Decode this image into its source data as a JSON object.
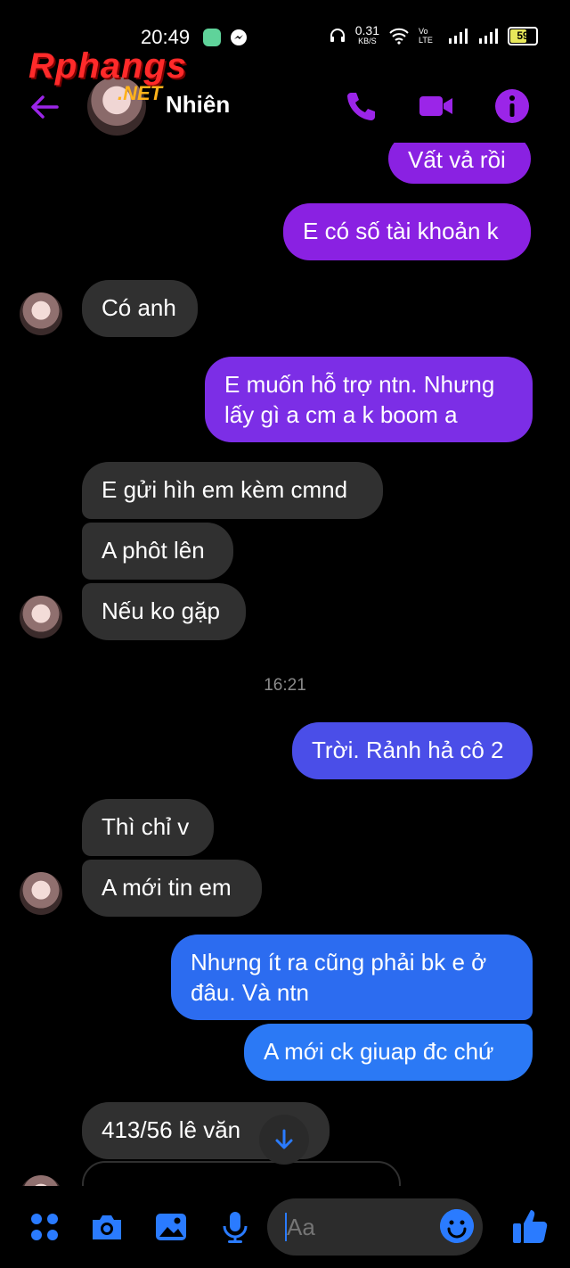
{
  "status_bar": {
    "time": "20:49",
    "net_speed": "0.31",
    "net_unit": "KB/S",
    "volte": "Vo LTE",
    "battery": "59"
  },
  "header": {
    "contact_name": "Nhiên",
    "watermark_main": "Rphangs",
    "watermark_sub": ".NET",
    "accent_color": "#9b25e8"
  },
  "messages": [
    {
      "dir": "out",
      "text": "Vất vả rồi",
      "color": "#8a21e2"
    },
    {
      "dir": "out",
      "text": "E có số tài khoản k",
      "color": "#8a21e2"
    },
    {
      "dir": "in",
      "text": "Có anh"
    },
    {
      "dir": "out",
      "lines": [
        "E muốn hỗ trợ ntn. Nhưng",
        "lấy gì a cm a k boom a"
      ],
      "color": "#7c2ee6"
    },
    {
      "dir": "in",
      "text": "E gửi hìh em kèm cmnd"
    },
    {
      "dir": "in",
      "text": "A phôt lên"
    },
    {
      "dir": "in",
      "text": "Nếu ko gặp"
    },
    {
      "dir": "in",
      "text": "Thì chỉ v"
    },
    {
      "dir": "in",
      "text": "A mới tin em"
    },
    {
      "dir": "out",
      "text": "Trời. Rảnh hả cô 2",
      "color": "#4a4ee8"
    },
    {
      "dir": "out",
      "lines": [
        "Nhưng ít ra cũng phải bk e ở",
        "đâu. Và ntn"
      ],
      "color": "#2c6cf0"
    },
    {
      "dir": "out",
      "text": "A mới ck giuap đc chứ",
      "color": "#2b79f5"
    },
    {
      "dir": "in",
      "text": "413/56 lê văn"
    }
  ],
  "time_separator": "16:21",
  "composer": {
    "placeholder": "Aa",
    "accent_color": "#2a7bff"
  }
}
